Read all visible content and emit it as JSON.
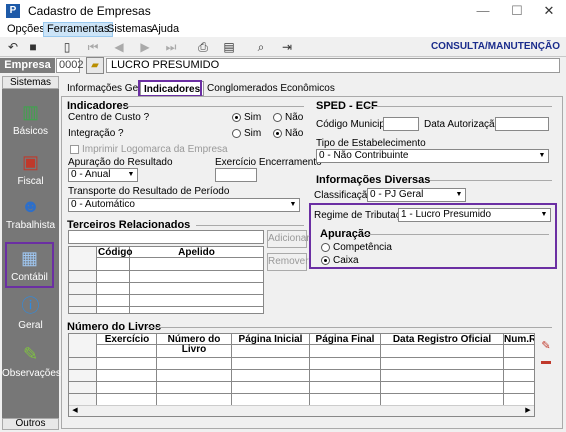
{
  "window": {
    "title": "Cadastro de Empresas",
    "app_icon": "P"
  },
  "menu": [
    "Opções",
    "Ferramentas",
    "Sistemas",
    "Ajuda"
  ],
  "toolbar": {
    "mode": "CONSULTA/MANUTENÇÃO"
  },
  "empresa": {
    "label": "Empresa",
    "code": "0002",
    "name": "LUCRO PRESUMIDO"
  },
  "sidebar": {
    "header": "Sistemas",
    "footer": "Outros",
    "items": [
      {
        "label": "Básicos",
        "icon": "book-icon"
      },
      {
        "label": "Fiscal",
        "icon": "film-icon"
      },
      {
        "label": "Trabalhista",
        "icon": "worker-icon"
      },
      {
        "label": "Contábil",
        "icon": "calculator-icon"
      },
      {
        "label": "Geral",
        "icon": "info-icon"
      },
      {
        "label": "Observações",
        "icon": "pencil-icon"
      }
    ]
  },
  "tabs": [
    "Informações Gerais",
    "Indicadores",
    "Conglomerados Econômicos"
  ],
  "indicadores": {
    "title": "Indicadores",
    "centro_custo": "Centro de Custo ?",
    "integracao": "Integração ?",
    "sim": "Sim",
    "nao": "Não",
    "imprimir_logo": "Imprimir Logomarca da Empresa",
    "apuracao_resultado_label": "Apuração do Resultado",
    "apuracao_resultado_value": "0 - Anual",
    "exercicio_label": "Exercício Encerramento",
    "transporte_label": "Transporte do Resultado de Período",
    "transporte_value": "0 - Automático"
  },
  "sped": {
    "title": "SPED - ECF",
    "codigo_municipio": "Código Municipio :",
    "data_autorizacao": "Data Autorização :",
    "tipo_estab_label": "Tipo de Estabelecimento",
    "tipo_estab_value": "0 - Não Contribuinte"
  },
  "info_diversas": {
    "title": "Informações Diversas",
    "classificacao_label": "Classificação :",
    "classificacao_value": "0 - PJ Geral",
    "regime_label": "Regime de Tributação :",
    "regime_value": "1 - Lucro Presumido",
    "apuracao_title": "Apuração",
    "competencia": "Competência",
    "caixa": "Caixa"
  },
  "terceiros": {
    "title": "Terceiros Relacionados",
    "col_codigo": "Código",
    "col_apelido": "Apelido",
    "adicionar": "Adicionar",
    "remover": "Remover"
  },
  "livros": {
    "title": "Número do Livros",
    "columns": [
      "Exercício",
      "Número do Livro",
      "Página Inicial",
      "Página Final",
      "Data Registro Oficial",
      "Num.Re"
    ]
  }
}
